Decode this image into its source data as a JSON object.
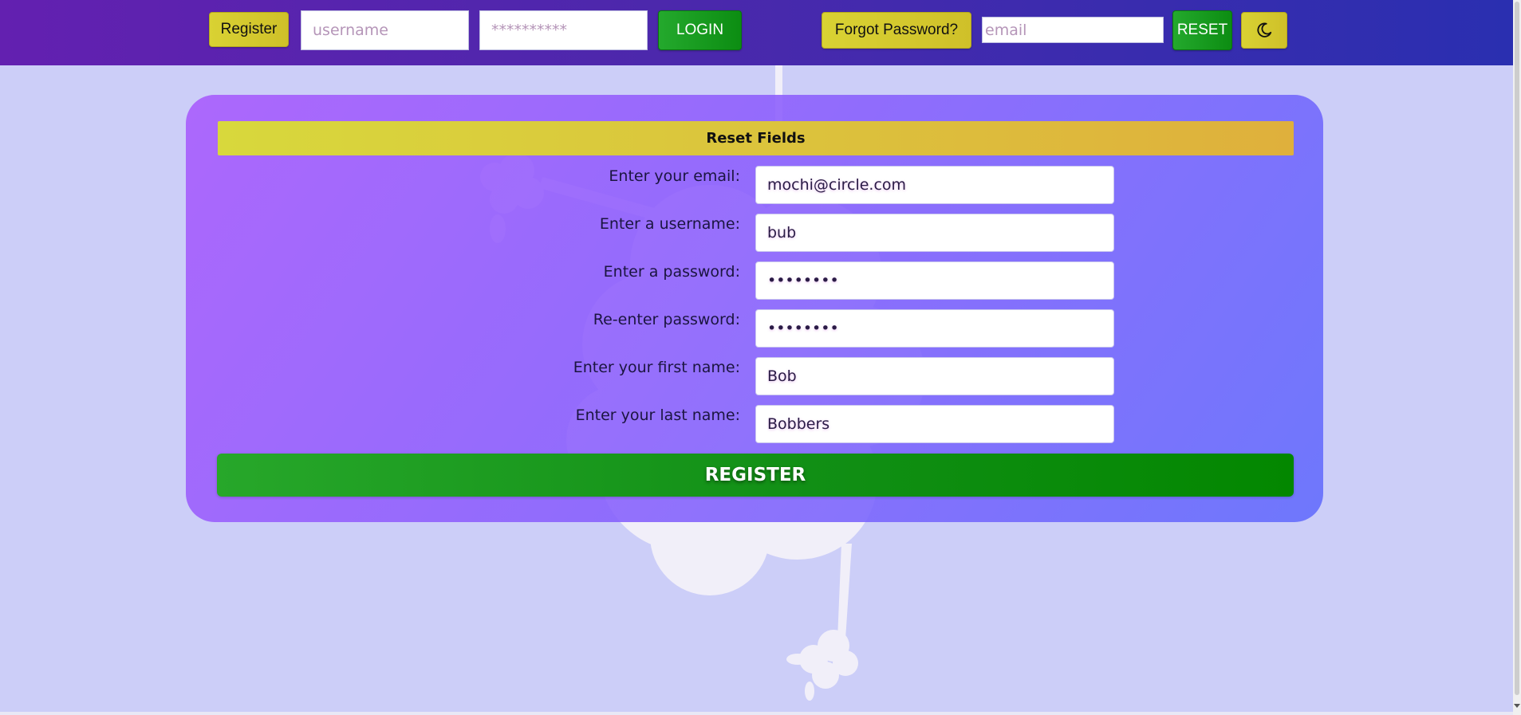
{
  "topbar": {
    "register_label": "Register",
    "username_placeholder": "username",
    "password_placeholder": "**********",
    "login_label": "LOGIN",
    "forgot_label": "Forgot Password?",
    "email_placeholder": "email",
    "reset_label": "RESET",
    "theme_icon": "moon-icon"
  },
  "form": {
    "reset_fields_label": "Reset Fields",
    "fields": {
      "email": {
        "label": "Enter your email:",
        "value": "mochi@circle.com"
      },
      "username": {
        "label": "Enter a username:",
        "value": "bub"
      },
      "password": {
        "label": "Enter a password:",
        "value": "••••••••"
      },
      "reenter": {
        "label": "Re-enter password:",
        "value": "••••••••"
      },
      "firstname": {
        "label": "Enter your first name:",
        "value": "Bob"
      },
      "lastname": {
        "label": "Enter your last name:",
        "value": "Bobbers"
      }
    },
    "register_label": "REGISTER"
  },
  "colors": {
    "page_background": "#cccef8",
    "accent_yellow": "#d9d233",
    "accent_green": "#0c8d12",
    "topbar_start": "#6320b0",
    "topbar_end": "#2a2fb0"
  }
}
